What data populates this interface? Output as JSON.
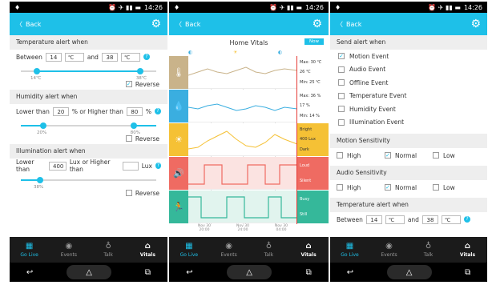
{
  "status": {
    "time": "14:26",
    "icons": "⏰ ✈ ▮▮ ▬"
  },
  "appbar": {
    "back_label": "Back"
  },
  "nav": {
    "tabs": [
      {
        "label": "Go Live",
        "icon": "▦"
      },
      {
        "label": "Events",
        "icon": "◉"
      },
      {
        "label": "Talk",
        "icon": "♁"
      },
      {
        "label": "Vitals",
        "icon": "⌂"
      }
    ]
  },
  "sys": {
    "back": "↩",
    "recent": "⧉"
  },
  "screen1": {
    "temp_title": "Temperature alert when",
    "between_label": "Between",
    "temp_low": "14",
    "temp_unit1": "℃",
    "and_label": "and",
    "temp_high": "38",
    "temp_unit2": "℃",
    "temp_slider": {
      "min_label": "14℃",
      "max_label": "38℃",
      "low": 0.14,
      "high": 0.85
    },
    "reverse_label": "Reverse",
    "hum_title": "Humidity alert when",
    "lower_than": "Lower than",
    "hum_low": "20",
    "pct_or_higher": "% or Higher than",
    "hum_high": "80",
    "pct": "%",
    "hum_slider": {
      "min_label": "20%",
      "max_label": "80%",
      "low": 0.2,
      "high": 0.8
    },
    "illum_title": "Illumination alert when",
    "illum_low": "400",
    "lux_or_higher": "Lux or Higher than",
    "illum_high": "",
    "lux": "Lux",
    "illum_slider": {
      "min_label": "38%",
      "low": 0.2
    }
  },
  "screen2": {
    "title": "Home Vitals",
    "now_label": "Now",
    "temp_side": [
      "Max:  30 ℃",
      "26 ℃",
      "Min:  25 ℃"
    ],
    "hum_side": [
      "Max:  36 %",
      "17 %",
      "Min:  14 %"
    ],
    "light_side": [
      "Bright",
      "400 Lux",
      "Dark"
    ],
    "sound_side": [
      "Loud",
      "Silent"
    ],
    "motion_side": [
      "Busy",
      "Still"
    ],
    "x_labels": [
      "Nov 30\n20:00",
      "Nov 30\n24:00",
      "Nov 30\n04:00"
    ],
    "colors": {
      "temp": "#c9b38a",
      "humidity": "#3aaee0",
      "light": "#f5c135",
      "sound": "#ef6b62",
      "motion": "#35b89a"
    }
  },
  "screen3": {
    "send_title": "Send alert when",
    "events": [
      {
        "label": "Motion Event",
        "checked": "✓"
      },
      {
        "label": "Audio Event",
        "checked": ""
      },
      {
        "label": "Offline Event",
        "checked": ""
      },
      {
        "label": "Temperature Event",
        "checked": ""
      },
      {
        "label": "Humidity Event",
        "checked": ""
      },
      {
        "label": "Illumination Event",
        "checked": ""
      }
    ],
    "motion_title": "Motion Sensitivity",
    "audio_title": "Audio Sensitivity",
    "opts": [
      "High",
      "Normal",
      "Low"
    ],
    "check": "✓",
    "temp_title": "Temperature alert when",
    "between_label": "Between",
    "temp_low": "14",
    "temp_unit1": "℃",
    "and_label": "and",
    "temp_high": "38",
    "temp_unit2": "℃"
  }
}
